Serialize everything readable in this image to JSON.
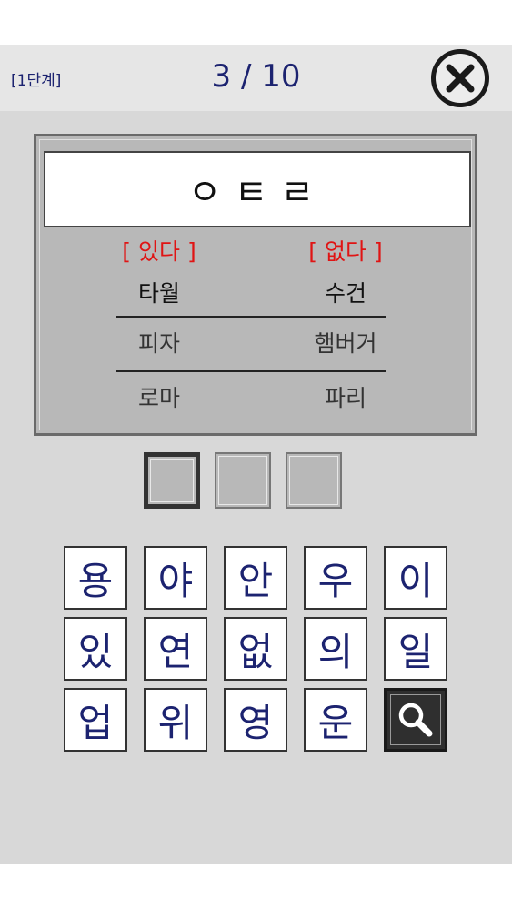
{
  "header": {
    "stage_label": "[1단계]",
    "progress": "3 / 10"
  },
  "quiz": {
    "hint": "ㅇㅌㄹ",
    "left_header": "[ 있다 ]",
    "right_header": "[ 없다 ]",
    "left_words": [
      "타월",
      "피자",
      "로마"
    ],
    "right_words": [
      "수건",
      "햄버거",
      "파리"
    ]
  },
  "answer": {
    "slot_count": 3,
    "active_slot": 0
  },
  "keypad": {
    "keys": [
      "용",
      "야",
      "안",
      "우",
      "이",
      "있",
      "연",
      "없",
      "의",
      "일",
      "업",
      "위",
      "영",
      "운"
    ],
    "search_icon": "magnifier-icon"
  },
  "colors": {
    "accent_navy": "#1c2370",
    "header_red": "#e01414",
    "panel_gray": "#b8b8b8"
  }
}
